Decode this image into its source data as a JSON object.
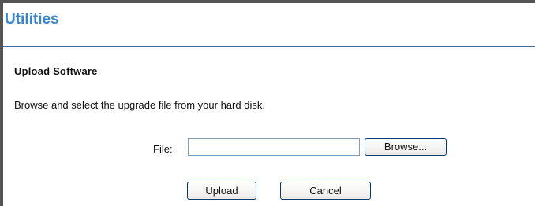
{
  "header": {
    "title": "Utilities"
  },
  "section": {
    "heading": "Upload Software",
    "instructions": "Browse and select the upgrade file from your hard disk."
  },
  "file_field": {
    "label": "File:",
    "value": "",
    "browse_label": "Browse..."
  },
  "actions": {
    "upload_label": "Upload",
    "cancel_label": "Cancel"
  },
  "colors": {
    "title": "#3b86c8",
    "rule": "#3b6fae",
    "frame_border": "#555555"
  }
}
